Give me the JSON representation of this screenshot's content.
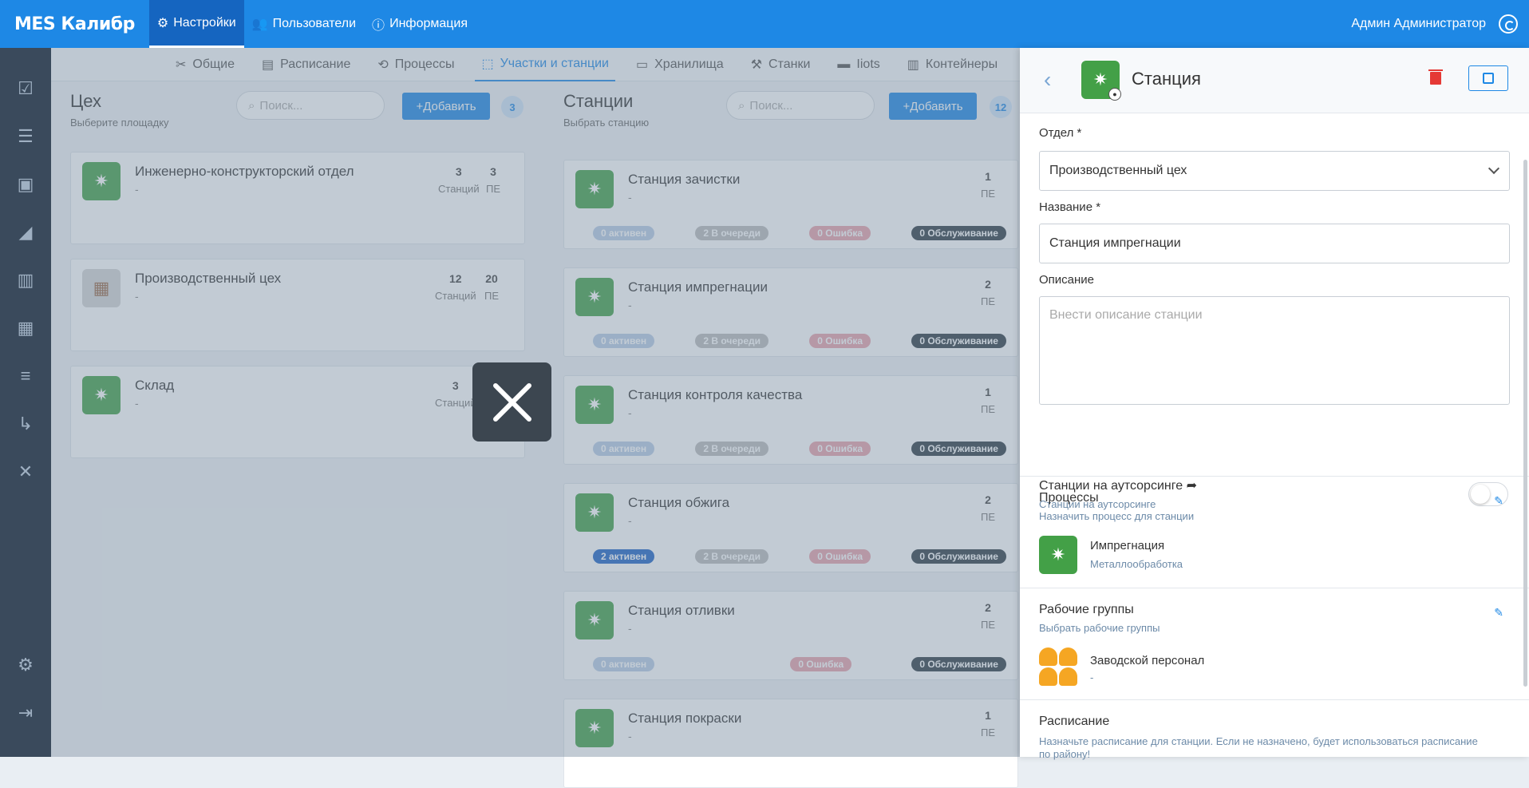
{
  "app": {
    "brand": "MES Калибр",
    "user": "Админ Администратор"
  },
  "topnav": [
    {
      "label": "Настройки",
      "icon": "gears-icon",
      "active": true
    },
    {
      "label": "Пользователи",
      "icon": "users-icon",
      "active": false
    },
    {
      "label": "Информация",
      "icon": "info-icon",
      "active": false
    }
  ],
  "sidebar": [
    "tasks-icon",
    "sliders-icon",
    "save-icon",
    "area-chart-icon",
    "bar-chart-icon",
    "line-chart-icon",
    "list-icon",
    "flow-icon",
    "tools-icon"
  ],
  "subtabs": [
    {
      "label": "Общие",
      "active": false
    },
    {
      "label": "Расписание",
      "active": false
    },
    {
      "label": "Процессы",
      "active": false
    },
    {
      "label": "Участки и станции",
      "active": true
    },
    {
      "label": "Хранилища",
      "active": false
    },
    {
      "label": "Станки",
      "active": false
    },
    {
      "label": "Iiots",
      "active": false
    },
    {
      "label": "Контейнеры",
      "active": false
    }
  ],
  "workshops": {
    "title": "Цех",
    "subtitle": "Выберите площадку",
    "search_placeholder": "Поиск...",
    "add_label": "+Добавить",
    "count": "3",
    "items": [
      {
        "name": "Инженерно-конструкторский отдел",
        "desc": "-",
        "stations": "3",
        "pe": "3",
        "stations_label": "Станций",
        "pe_label": "ПЕ"
      },
      {
        "name": "Производственный цех",
        "desc": "-",
        "stations": "12",
        "pe": "20",
        "stations_label": "Станций",
        "pe_label": "ПЕ"
      },
      {
        "name": "Склад",
        "desc": "-",
        "stations": "3",
        "stations_label": "Станций"
      }
    ]
  },
  "stations": {
    "title": "Станции",
    "subtitle": "Выбрать станцию",
    "search_placeholder": "Поиск...",
    "add_label": "+Добавить",
    "count": "12",
    "items": [
      {
        "name": "Станция зачистки",
        "desc": "-",
        "pe": "1",
        "pe_label": "ПЕ",
        "active": "0 активен",
        "queue": "2 В очереди",
        "error": "0 Ошибка",
        "maint": "0 Обслуживание"
      },
      {
        "name": "Станция импрегнации",
        "desc": "-",
        "pe": "2",
        "pe_label": "ПЕ",
        "active": "0 активен",
        "queue": "2 В очереди",
        "error": "0 Ошибка",
        "maint": "0 Обслуживание"
      },
      {
        "name": "Станция контроля качества",
        "desc": "-",
        "pe": "1",
        "pe_label": "ПЕ",
        "active": "0 активен",
        "queue": "2 В очереди",
        "error": "0 Ошибка",
        "maint": "0 Обслуживание"
      },
      {
        "name": "Станция обжига",
        "desc": "-",
        "pe": "2",
        "pe_label": "ПЕ",
        "active": "2 активен",
        "queue": "2 В очереди",
        "error": "0 Ошибка",
        "maint": "0 Обслуживание"
      },
      {
        "name": "Станция отливки",
        "desc": "-",
        "pe": "2",
        "pe_label": "ПЕ",
        "active": "0 активен",
        "queue": "",
        "error": "0 Ошибка",
        "maint": "0 Обслуживание"
      },
      {
        "name": "Станция покраски",
        "desc": "-",
        "pe": "1",
        "pe_label": "ПЕ"
      }
    ]
  },
  "panel": {
    "title": "Станция",
    "dept_label": "Отдел *",
    "dept_value": "Производственный цех",
    "name_label": "Название *",
    "name_value": "Станция импрегнации",
    "desc_label": "Описание",
    "desc_placeholder": "Внести описание станции",
    "outsource_title": "Станции на аутсорсинге",
    "outsource_sub": "Станции на аутсорсинге",
    "processes_title": "Процессы",
    "processes_sub": "Назначить процесс для станции",
    "process_name": "Импрегнация",
    "process_sub": "Металлообработка",
    "groups_title": "Рабочие группы",
    "groups_sub": "Выбрать рабочие группы",
    "group_name": "Заводской персонал",
    "group_sub": "-",
    "schedule_title": "Расписание",
    "schedule_sub": "Назначьте расписание для станции. Если не назначено, будет использоваться расписание по району!"
  }
}
